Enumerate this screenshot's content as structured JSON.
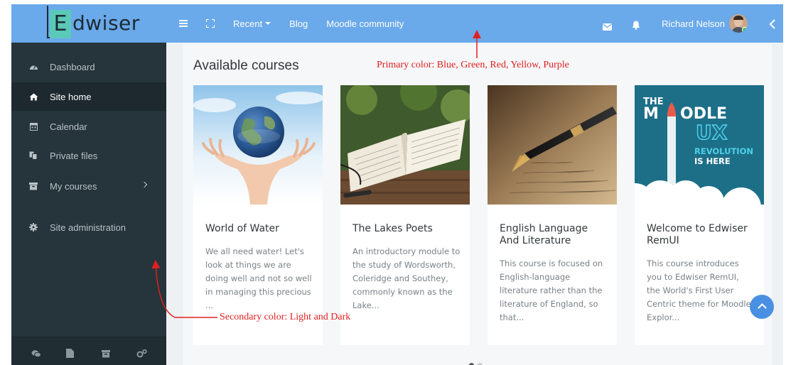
{
  "brand": {
    "logo_letter": "E",
    "logo_text": "dwiser"
  },
  "navbar": {
    "menu_icon": "hamburger-icon",
    "fullscreen_icon": "expand-icon",
    "recent_label": "Recent",
    "blog_label": "Blog",
    "community_label": "Moodle community",
    "mail_icon": "envelope-icon",
    "notif_icon": "bell-icon",
    "user_name": "Richard Nelson",
    "collapse_icon": "chevron-left-icon"
  },
  "sidebar": {
    "items": [
      {
        "label": "Dashboard",
        "icon": "dashboard-icon"
      },
      {
        "label": "Site home",
        "icon": "home-icon"
      },
      {
        "label": "Calendar",
        "icon": "calendar-icon"
      },
      {
        "label": "Private files",
        "icon": "files-icon"
      },
      {
        "label": "My courses",
        "icon": "archive-icon"
      },
      {
        "label": "Site administration",
        "icon": "cog-icon"
      }
    ],
    "bottom_icons": [
      "comments-icon",
      "file-icon",
      "archive-icon",
      "cogs-icon"
    ]
  },
  "main": {
    "title": "Available courses",
    "courses": [
      {
        "title": "World of Water",
        "desc": "We all need water! Let's look at things we are doing well and not so well in managing this precious ..."
      },
      {
        "title": "The Lakes Poets",
        "desc": "An introductory module to the study of Wordsworth, Coleridge and Southey, commonly known as the Lake..."
      },
      {
        "title": "English Language And Literature",
        "desc": "This course is focused on English-language literature rather than the literature of England, so that..."
      },
      {
        "title": "Welcome to Edwiser RemUI",
        "desc": "This course introduces you to Edwiser RemUI, the World's First User Centric theme for Moodle. Explor..."
      }
    ],
    "moodle_ux_image": {
      "line1": "THE",
      "line2": "M",
      "line3": "ODLE",
      "line4": "UX",
      "line5": "REVOLUTION",
      "line6": "IS HERE"
    }
  },
  "annotations": {
    "primary": "Primary color: Blue, Green, Red, Yellow, Purple",
    "secondary": "Secondary color: Light and Dark"
  },
  "colors": {
    "primary": "#6aa9ea",
    "sidebar": "#26343b",
    "annotation": "#e02020",
    "scroll_button": "#4a90e2"
  }
}
